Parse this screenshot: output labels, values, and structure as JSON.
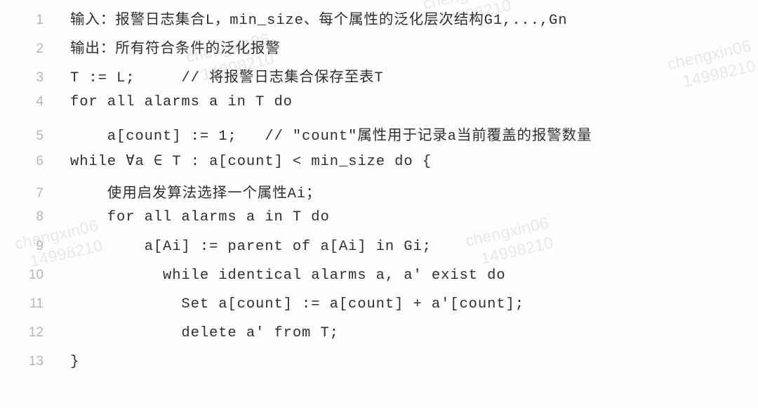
{
  "code_block": {
    "language": "pseudocode",
    "background_color": "#fdfdfd",
    "text_color": "#2f2f2f",
    "line_number_color": "#b6b6b6",
    "watermark": {
      "name": "chengxin06",
      "number": "14998210",
      "color": "#e9e7e7"
    },
    "lines": [
      {
        "number": "1",
        "text": "输入：报警日志集合L，min_size、每个属性的泛化层次结构G1,...,Gn"
      },
      {
        "number": "2",
        "text": "输出：所有符合条件的泛化报警"
      },
      {
        "number": "3",
        "text": "T := L;     // 将报警日志集合保存至表T"
      },
      {
        "number": "4",
        "text": "for all alarms a in T do"
      },
      {
        "number": "5",
        "text": "    a[count] := 1;   // \"count\"属性用于记录a当前覆盖的报警数量"
      },
      {
        "number": "6",
        "text": "while ∀a ∈ T : a[count] < min_size do {"
      },
      {
        "number": "7",
        "text": "    使用启发算法选择一个属性Ai；"
      },
      {
        "number": "8",
        "text": "    for all alarms a in T do"
      },
      {
        "number": "9",
        "text": "        a[Ai] := parent of a[Ai] in Gi;"
      },
      {
        "number": "10",
        "text": "          while identical alarms a, a' exist do"
      },
      {
        "number": "11",
        "text": "            Set a[count] := a[count] + a'[count];"
      },
      {
        "number": "12",
        "text": "            delete a' from T;"
      },
      {
        "number": "13",
        "text": "}"
      }
    ]
  }
}
